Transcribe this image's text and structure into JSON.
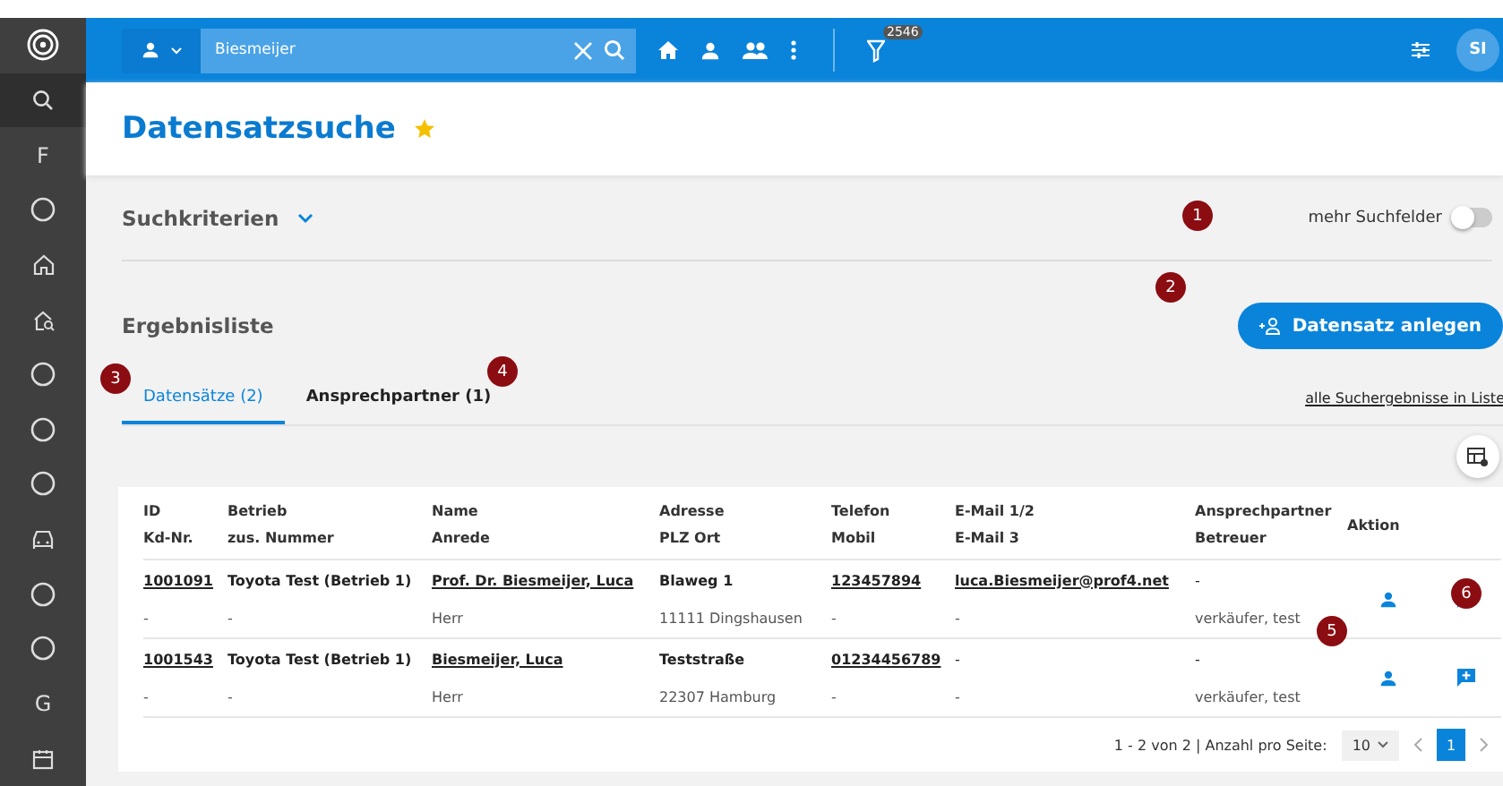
{
  "sidebar": {
    "items": [
      {
        "kind": "logo"
      },
      {
        "kind": "search",
        "selected": true
      },
      {
        "kind": "letter",
        "label": "F"
      },
      {
        "kind": "circle"
      },
      {
        "kind": "home"
      },
      {
        "kind": "home-search"
      },
      {
        "kind": "circle"
      },
      {
        "kind": "circle"
      },
      {
        "kind": "circle"
      },
      {
        "kind": "car"
      },
      {
        "kind": "circle"
      },
      {
        "kind": "circle"
      },
      {
        "kind": "letter",
        "label": "G"
      },
      {
        "kind": "calendar"
      }
    ]
  },
  "header": {
    "search_value": "Biesmeijer",
    "filter_count": "2546",
    "avatar": "SI"
  },
  "page": {
    "title": "Datensatzsuche",
    "favorite": true
  },
  "criteria": {
    "label": "Suchkriterien",
    "expanded": false,
    "more_fields_label": "mehr Suchfelder",
    "more_fields_on": false
  },
  "results": {
    "title": "Ergebnisliste",
    "create_button": "Datensatz anlegen",
    "all_link": "alle Suchergebnisse in Liste",
    "tabs": [
      {
        "label": "Datensätze (2)",
        "selected": true
      },
      {
        "label": "Ansprechpartner (1)",
        "selected": false
      }
    ]
  },
  "table": {
    "columns": [
      {
        "label": "ID",
        "sublabel": "Kd-Nr."
      },
      {
        "label": "Betrieb",
        "sublabel": "zus. Nummer"
      },
      {
        "label": "Name",
        "sublabel": "Anrede"
      },
      {
        "label": "Adresse",
        "sublabel": "PLZ Ort"
      },
      {
        "label": "Telefon",
        "sublabel": "Mobil"
      },
      {
        "label": "E-Mail 1/2",
        "sublabel": "E-Mail 3"
      },
      {
        "label": "Ansprechpartner",
        "sublabel": "Betreuer"
      },
      {
        "label": "Aktion"
      }
    ],
    "rows": [
      {
        "cells": [
          [
            "1001091",
            "-"
          ],
          [
            "Toyota Test (Betrieb 1)",
            "-"
          ],
          [
            "Prof. Dr. Biesmeijer, Luca",
            "Herr"
          ],
          [
            "Blaweg 1",
            "11111 Dingshausen"
          ],
          [
            "123457894",
            "-"
          ],
          [
            "luca.Biesmeijer@prof4.net",
            "-"
          ],
          [
            "-",
            "verkäufer, test"
          ]
        ]
      },
      {
        "cells": [
          [
            "1001543",
            "-"
          ],
          [
            "Toyota Test (Betrieb 1)",
            "-"
          ],
          [
            "Biesmeijer, Luca",
            "Herr"
          ],
          [
            "Teststraße",
            "22307 Hamburg"
          ],
          [
            "01234456789",
            "-"
          ],
          [
            "-",
            "-"
          ],
          [
            "-",
            "verkäufer, test"
          ]
        ]
      }
    ]
  },
  "pagination": {
    "summary": "1 - 2 von 2 | Anzahl pro Seite:",
    "page_size": "10",
    "pages": [
      {
        "label": "1",
        "selected": true
      }
    ]
  },
  "annotations": [
    "1",
    "2",
    "3",
    "4",
    "5",
    "6"
  ]
}
